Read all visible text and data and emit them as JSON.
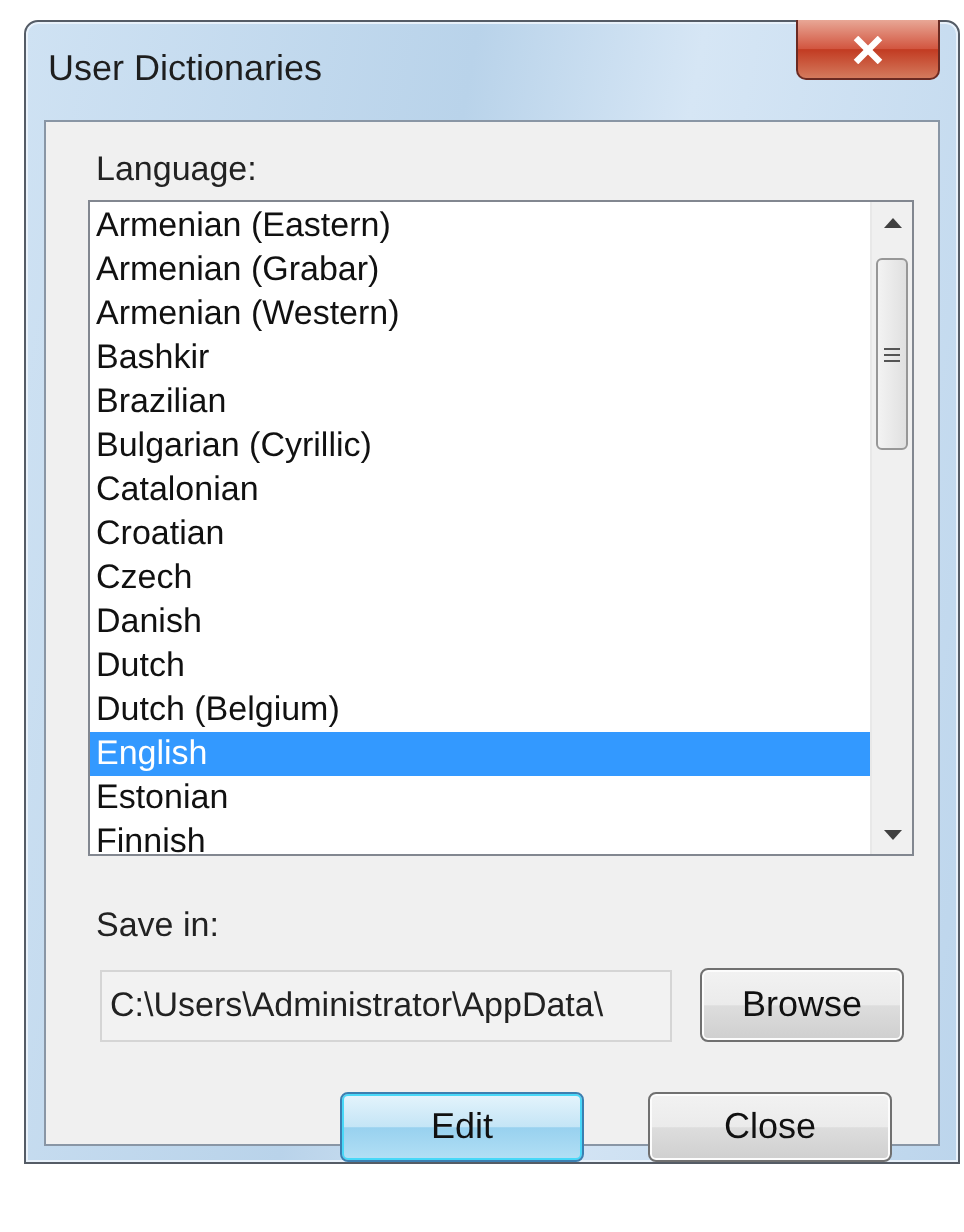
{
  "window": {
    "title": "User Dictionaries"
  },
  "language_list": {
    "label": "Language:",
    "items": [
      {
        "text": "Armenian (Eastern)",
        "selected": false
      },
      {
        "text": "Armenian (Grabar)",
        "selected": false
      },
      {
        "text": "Armenian (Western)",
        "selected": false
      },
      {
        "text": "Bashkir",
        "selected": false
      },
      {
        "text": "Brazilian",
        "selected": false
      },
      {
        "text": "Bulgarian (Cyrillic)",
        "selected": false
      },
      {
        "text": "Catalonian",
        "selected": false
      },
      {
        "text": "Croatian",
        "selected": false
      },
      {
        "text": "Czech",
        "selected": false
      },
      {
        "text": "Danish",
        "selected": false
      },
      {
        "text": "Dutch",
        "selected": false
      },
      {
        "text": "Dutch (Belgium)",
        "selected": false
      },
      {
        "text": "English",
        "selected": true
      },
      {
        "text": "Estonian",
        "selected": false
      },
      {
        "text": "Finnish",
        "selected": false
      }
    ]
  },
  "save_in": {
    "label": "Save in:",
    "value": "C:\\Users\\Administrator\\AppData\\",
    "browse_button": "Browse"
  },
  "buttons": [
    {
      "label": "Edit",
      "default": true
    },
    {
      "label": "Close",
      "default": false
    }
  ]
}
